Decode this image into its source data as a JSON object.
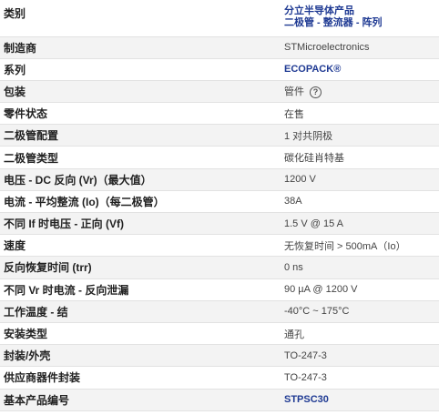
{
  "specs": {
    "category": {
      "label": "类别",
      "line1": "分立半导体产品",
      "line2": "二极管 - 整流器 - 阵列"
    },
    "manufacturer": {
      "label": "制造商",
      "value": "STMicroelectronics"
    },
    "series": {
      "label": "系列",
      "value": "ECOPACK®"
    },
    "package": {
      "label": "包装",
      "value": "管件",
      "icon": "help-icon",
      "icon_glyph": "?"
    },
    "part_status": {
      "label": "零件状态",
      "value": "在售"
    },
    "diode_config": {
      "label": "二极管配置",
      "value": "1 对共阴极"
    },
    "diode_type": {
      "label": "二极管类型",
      "value": "碳化硅肖特基"
    },
    "voltage_dc_reverse": {
      "label": "电压 - DC 反向 (Vr)（最大值）",
      "value": "1200 V"
    },
    "current_avg_rectified": {
      "label": "电流 - 平均整流 (Io)（每二极管）",
      "value": "38A"
    },
    "forward_voltage": {
      "label": "不同 If 时电压 - 正向 (Vf)",
      "value": "1.5 V @ 15 A"
    },
    "speed": {
      "label": "速度",
      "value": "无恢复时间 > 500mA（Io）"
    },
    "reverse_recovery_time": {
      "label": "反向恢复时间 (trr)",
      "value": "0 ns"
    },
    "reverse_leakage": {
      "label": "不同 Vr 时电流 - 反向泄漏",
      "value": "90 µA @ 1200 V"
    },
    "operating_temp": {
      "label": "工作温度 - 结",
      "value": "-40°C ~ 175°C"
    },
    "mounting_type": {
      "label": "安装类型",
      "value": "通孔"
    },
    "package_case": {
      "label": "封装/外壳",
      "value": "TO-247-3"
    },
    "supplier_package": {
      "label": "供应商器件封装",
      "value": "TO-247-3"
    },
    "base_part_number": {
      "label": "基本产品编号",
      "value": "STPSC30"
    }
  },
  "colors": {
    "link": "#1f3a93",
    "row_alt": "#f3f3f3",
    "border": "#e2e2e2"
  }
}
